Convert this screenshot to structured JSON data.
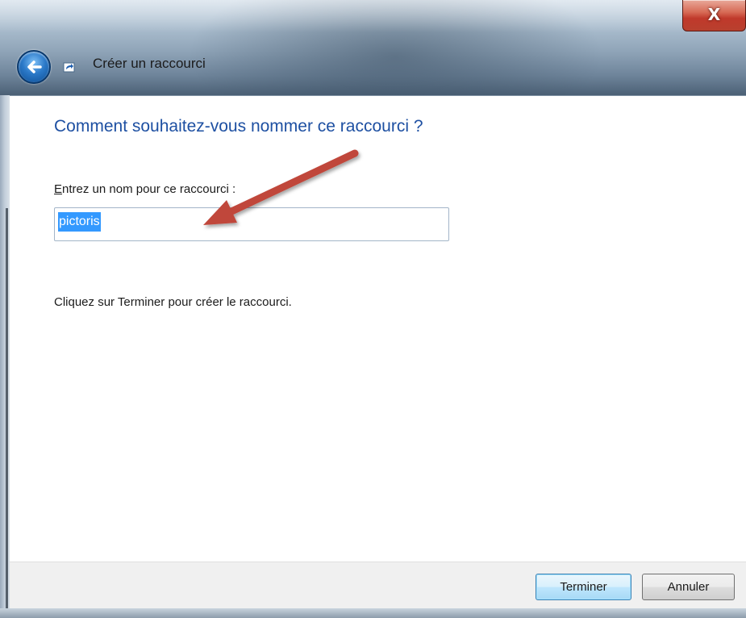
{
  "window": {
    "title": "Créer un raccourci",
    "close_label": "X"
  },
  "page": {
    "heading": "Comment souhaitez-vous nommer ce raccourci ?",
    "name_label_accel": "E",
    "name_label_rest": "ntrez un nom pour ce raccourci :",
    "name_value": "pictoris",
    "instruction": "Cliquez sur Terminer pour créer le raccourci."
  },
  "buttons": {
    "finish": "Terminer",
    "cancel": "Annuler"
  },
  "icons": {
    "back": "back-arrow-icon",
    "wizard": "shortcut-icon",
    "annotation": "red-pointer-arrow"
  },
  "colors": {
    "heading": "#1e50a2",
    "selection": "#3399ff",
    "annotation_arrow": "#c0463a"
  }
}
